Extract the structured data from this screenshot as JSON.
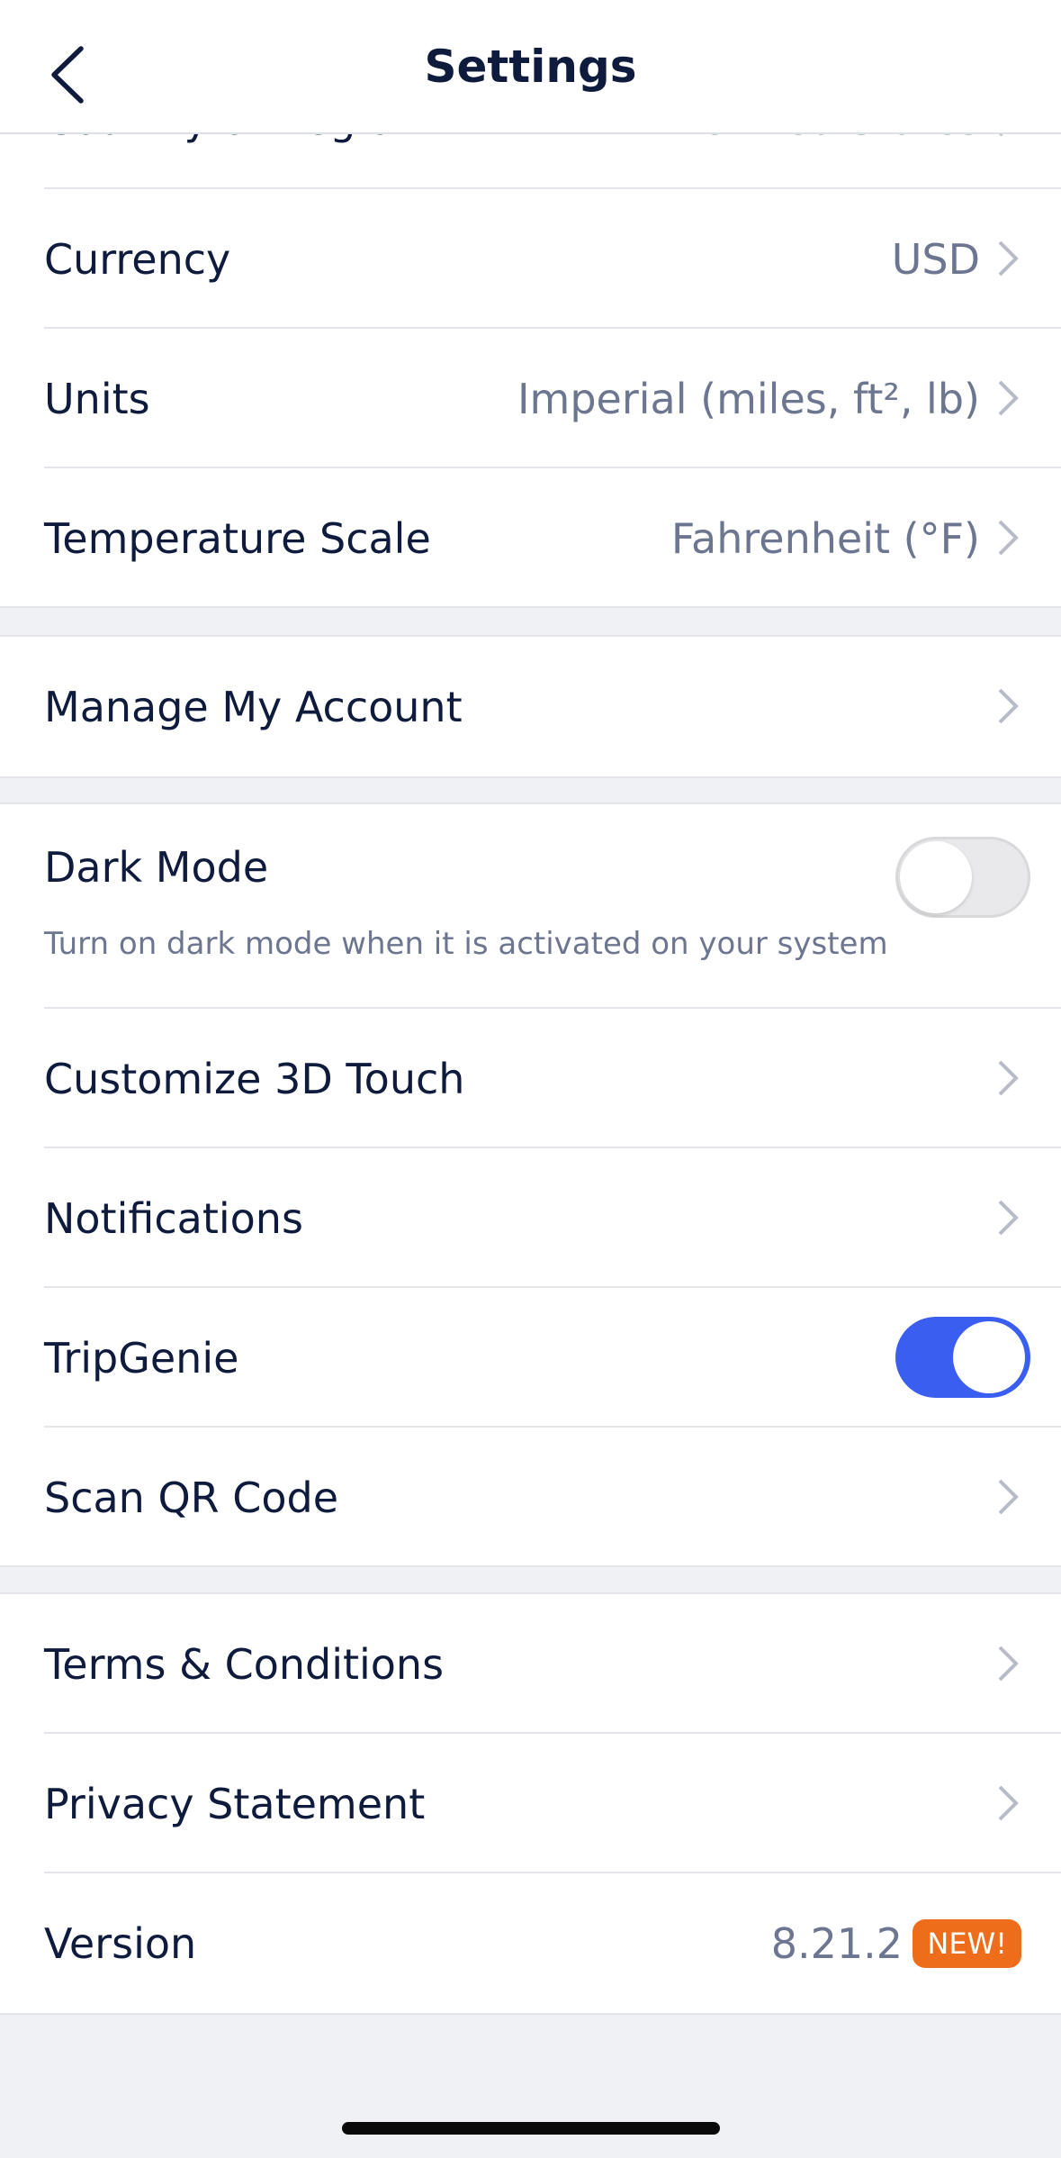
{
  "nav": {
    "title": "Settings",
    "back_icon": "chevron-left-icon"
  },
  "region_row": {
    "label": "Country or Region",
    "value": "United States"
  },
  "preferences": [
    {
      "label": "Currency",
      "value": "USD"
    },
    {
      "label": "Units",
      "value": "Imperial (miles, ft², lb)"
    },
    {
      "label": "Temperature Scale",
      "value": "Fahrenheit (°F)"
    }
  ],
  "account": {
    "label": "Manage My Account"
  },
  "dark_mode": {
    "label": "Dark Mode",
    "description": "Turn on dark mode when it is activated on your system",
    "enabled": false
  },
  "features": {
    "customize_3d_touch": "Customize 3D Touch",
    "notifications": "Notifications",
    "tripgenie": {
      "label": "TripGenie",
      "enabled": true
    },
    "scan_qr": "Scan QR Code"
  },
  "legal": {
    "terms": "Terms & Conditions",
    "privacy": "Privacy Statement",
    "version_label": "Version",
    "version_value": "8.21.2",
    "new_badge": "NEW!"
  },
  "colors": {
    "accent": "#3a5ef0",
    "badge": "#ee6d1b",
    "text_primary": "#0f1b3d",
    "text_secondary": "#6d7690",
    "background": "#f0f1f5"
  }
}
